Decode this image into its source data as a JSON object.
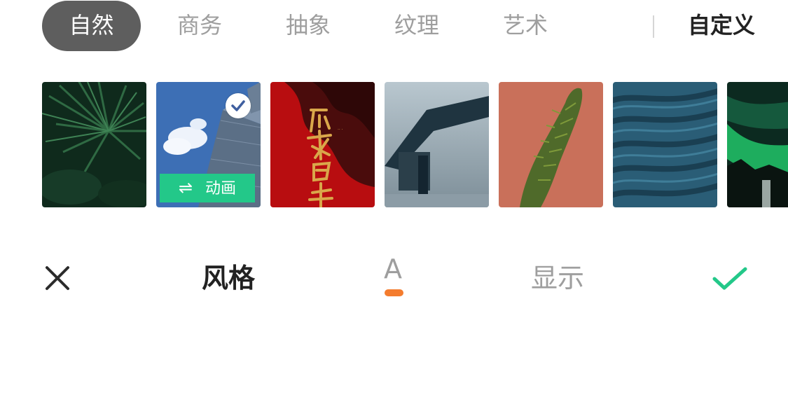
{
  "tabs": {
    "items": [
      {
        "label": "自然",
        "active": true
      },
      {
        "label": "商务",
        "active": false
      },
      {
        "label": "抽象",
        "active": false
      },
      {
        "label": "纹理",
        "active": false
      },
      {
        "label": "艺术",
        "active": false
      }
    ],
    "custom_label": "自定义"
  },
  "thumbnails": {
    "selected_index": 1,
    "animate_label": "动画",
    "animate_icon": "swap-arrows-icon",
    "items": [
      {
        "name": "palm-leaves"
      },
      {
        "name": "skyscraper-sky"
      },
      {
        "name": "red-gold-calligraphy"
      },
      {
        "name": "frosted-rail"
      },
      {
        "name": "green-fern-coral"
      },
      {
        "name": "blue-sand-waves"
      },
      {
        "name": "green-aurora"
      }
    ]
  },
  "toolbar": {
    "close_icon": "close-icon",
    "style_label": "风格",
    "font_label": "A",
    "display_label": "显示",
    "confirm_icon": "checkmark-icon",
    "accent_color": "#23c889",
    "indicator_color": "#f47c2e"
  }
}
